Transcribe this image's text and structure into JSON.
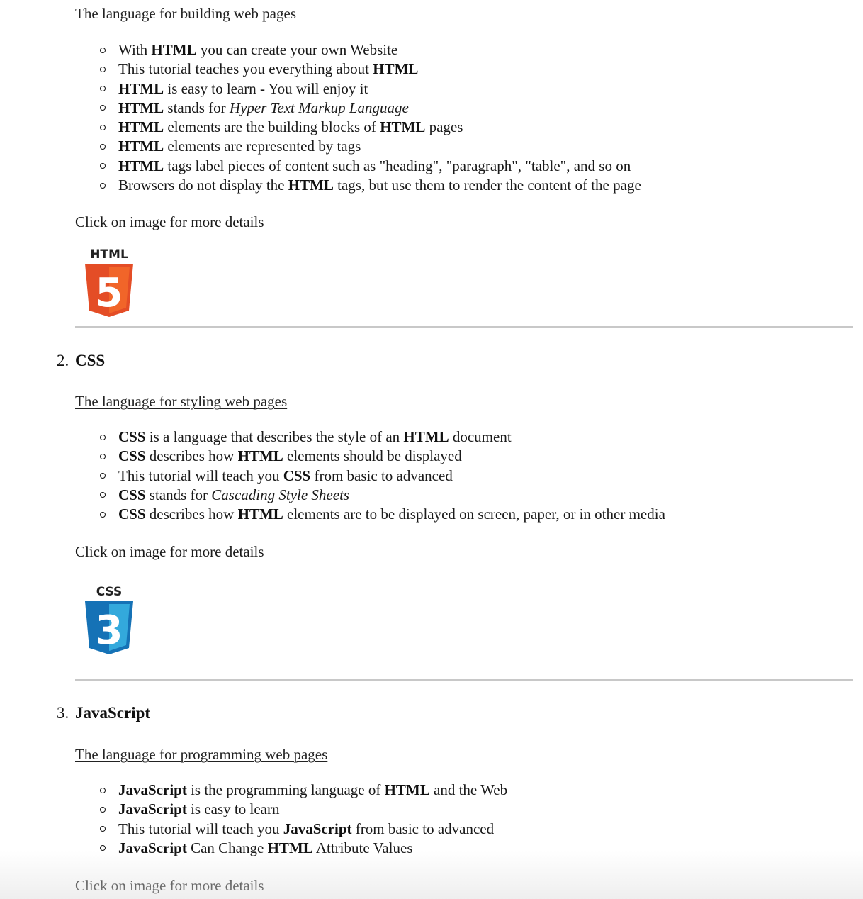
{
  "sections": [
    {
      "subtitle": "The language for building web pages",
      "bullets": [
        [
          {
            "t": "With "
          },
          {
            "t": "HTML",
            "b": true
          },
          {
            "t": " you can create your own Website"
          }
        ],
        [
          {
            "t": "This tutorial teaches you everything about "
          },
          {
            "t": "HTML",
            "b": true
          }
        ],
        [
          {
            "t": "HTML",
            "b": true
          },
          {
            "t": " is easy to learn - You will enjoy it"
          }
        ],
        [
          {
            "t": "HTML",
            "b": true
          },
          {
            "t": " stands for "
          },
          {
            "t": "Hyper Text Markup Language",
            "i": true
          }
        ],
        [
          {
            "t": "HTML",
            "b": true
          },
          {
            "t": " elements are the building blocks of "
          },
          {
            "t": "HTML",
            "b": true
          },
          {
            "t": " pages"
          }
        ],
        [
          {
            "t": "HTML",
            "b": true
          },
          {
            "t": " elements are represented by tags"
          }
        ],
        [
          {
            "t": "HTML",
            "b": true
          },
          {
            "t": " tags label pieces of content such as \"heading\", \"paragraph\", \"table\", and so on"
          }
        ],
        [
          {
            "t": "Browsers do not display the "
          },
          {
            "t": "HTML",
            "b": true
          },
          {
            "t": " tags, but use them to render the content of the page"
          }
        ]
      ],
      "click_text": "Click on image for more details",
      "logo": {
        "label": "HTML",
        "digit": "5",
        "color": "#e44d26",
        "color_light": "#f16529"
      }
    },
    {
      "number": "2.",
      "title": "CSS",
      "subtitle": "The language for styling web pages",
      "bullets": [
        [
          {
            "t": "CSS",
            "b": true
          },
          {
            "t": " is a language that describes the style of an "
          },
          {
            "t": "HTML",
            "b": true
          },
          {
            "t": " document"
          }
        ],
        [
          {
            "t": "CSS",
            "b": true
          },
          {
            "t": " describes how "
          },
          {
            "t": "HTML",
            "b": true
          },
          {
            "t": " elements should be displayed"
          }
        ],
        [
          {
            "t": "This tutorial will teach you "
          },
          {
            "t": "CSS",
            "b": true
          },
          {
            "t": " from basic to advanced"
          }
        ],
        [
          {
            "t": "CSS",
            "b": true
          },
          {
            "t": " stands for "
          },
          {
            "t": "Cascading Style Sheets",
            "i": true
          }
        ],
        [
          {
            "t": "CSS",
            "b": true
          },
          {
            "t": " describes how "
          },
          {
            "t": "HTML",
            "b": true
          },
          {
            "t": " elements are to be displayed on screen, paper, or in other media"
          }
        ]
      ],
      "click_text": "Click on image for more details",
      "logo": {
        "label": "CSS",
        "digit": "3",
        "color": "#1572b6",
        "color_light": "#33a9dc"
      }
    },
    {
      "number": "3.",
      "title": "JavaScript",
      "subtitle": "The language for programming web pages",
      "bullets": [
        [
          {
            "t": "JavaScript",
            "b": true
          },
          {
            "t": " is the programming language of "
          },
          {
            "t": "HTML",
            "b": true
          },
          {
            "t": " and the Web"
          }
        ],
        [
          {
            "t": "JavaScript",
            "b": true
          },
          {
            "t": " is easy to learn"
          }
        ],
        [
          {
            "t": "This tutorial will teach you "
          },
          {
            "t": "JavaScript",
            "b": true
          },
          {
            "t": " from basic to advanced"
          }
        ],
        [
          {
            "t": "JavaScript",
            "b": true
          },
          {
            "t": " Can Change "
          },
          {
            "t": "HTML",
            "b": true
          },
          {
            "t": " Attribute Values"
          }
        ]
      ],
      "click_text": "Click on image for more details"
    }
  ]
}
